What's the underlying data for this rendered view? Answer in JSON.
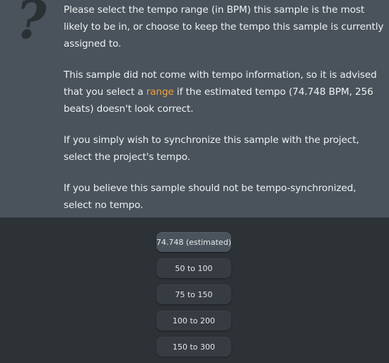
{
  "message": {
    "para1": "Please select the tempo range (in BPM) this sample is the most likely to be in, or choose to keep the tempo this sample is currently assigned to.",
    "para2_before": "This sample did not come with tempo information, so it is advised that you select a ",
    "para2_link": "range",
    "para2_after": " if the estimated tempo (74.748 BPM, 256 beats) doesn't look correct.",
    "para3": "If you simply wish to synchronize this sample with the project, select the project's tempo.",
    "para4": "If you believe this sample should not be tempo-synchronized, select no tempo."
  },
  "icon": "question-mark-icon",
  "colors": {
    "panel_bg": "#4a535c",
    "dialog_bg": "#2d3236",
    "button_bg": "#363c41",
    "link": "#f2a23a",
    "text": "#eef1f3"
  },
  "buttons": [
    {
      "label": "74.748 (estimated)"
    },
    {
      "label": "50 to 100"
    },
    {
      "label": "75 to 150"
    },
    {
      "label": "100 to 200"
    },
    {
      "label": "150 to 300"
    }
  ]
}
